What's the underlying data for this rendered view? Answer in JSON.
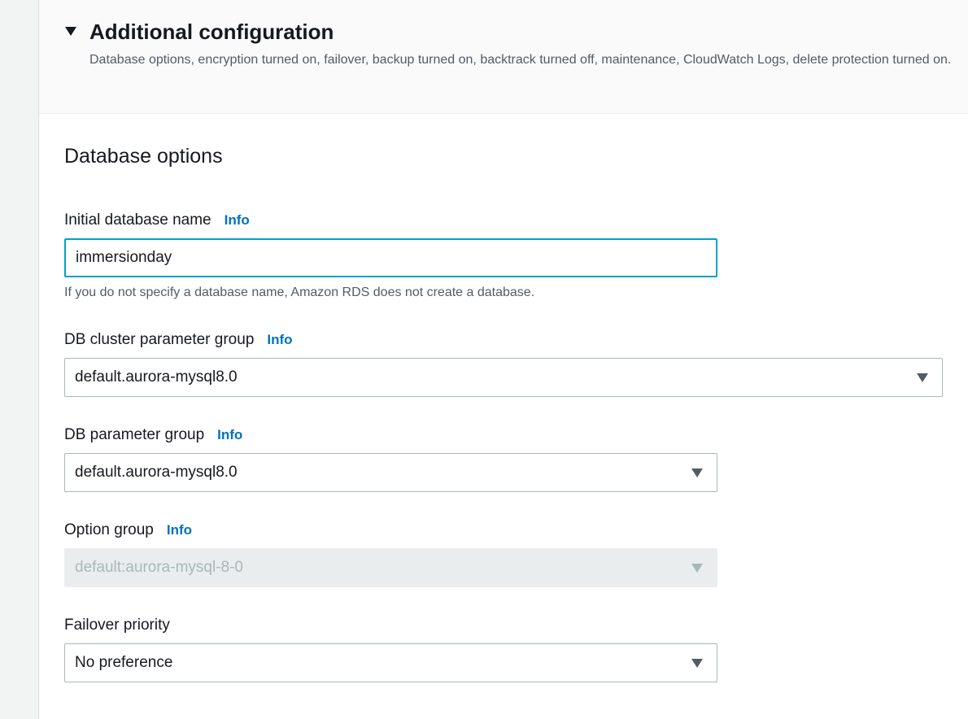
{
  "header": {
    "title": "Additional configuration",
    "description": "Database options, encryption turned on, failover, backup turned on, backtrack turned off, maintenance, CloudWatch Logs, delete protection turned on."
  },
  "section": {
    "title": "Database options"
  },
  "info_label": "Info",
  "fields": {
    "initial_db_name": {
      "label": "Initial database name",
      "value": "immersionday",
      "hint": "If you do not specify a database name, Amazon RDS does not create a database."
    },
    "cluster_param_group": {
      "label": "DB cluster parameter group",
      "value": "default.aurora-mysql8.0"
    },
    "db_param_group": {
      "label": "DB parameter group",
      "value": "default.aurora-mysql8.0"
    },
    "option_group": {
      "label": "Option group",
      "value": "default:aurora-mysql-8-0",
      "disabled": true
    },
    "failover_priority": {
      "label": "Failover priority",
      "value": "No preference"
    }
  },
  "icons": {
    "expand_toggle": "caret-down-icon",
    "select_caret": "caret-down-icon"
  },
  "colors": {
    "info_link": "#0073bb",
    "focus_border": "#00a1c9",
    "disabled_bg": "#eaeded"
  }
}
